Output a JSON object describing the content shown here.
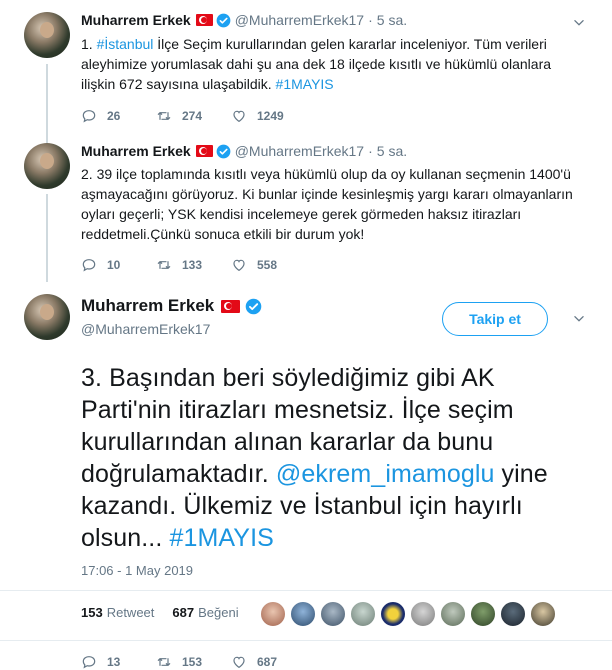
{
  "tweets": [
    {
      "name": "Muharrem Erkek",
      "handle": "@MuharremErkek17",
      "time": "5 sa.",
      "text_pre": "1. ",
      "text_link": "#İstanbul",
      "text_post": " İlçe Seçim kurullarından gelen kararlar inceleniyor. Tüm verileri aleyhimize yorumlasak dahi şu ana dek 18 ilçede kısıtlı ve hükümlü olanlara ilişkin 672 sayısına ulaşabildik. ",
      "text_tag": "#1MAYIS",
      "replies": "26",
      "retweets": "274",
      "likes": "1249"
    },
    {
      "name": "Muharrem Erkek",
      "handle": "@MuharremErkek17",
      "time": "5 sa.",
      "text": "2.  39 ilçe toplamında kısıtlı veya hükümlü olup da oy kullanan seçmenin 1400'ü aşmayacağını görüyoruz. Ki bunlar içinde kesinleşmiş yargı kararı olmayanların oyları geçerli; YSK kendisi incelemeye gerek görmeden haksız itirazları reddetmeli.Çünkü sonuca etkili bir durum yok!",
      "replies": "10",
      "retweets": "133",
      "likes": "558"
    }
  ],
  "main": {
    "name": "Muharrem Erkek",
    "handle": "@MuharremErkek17",
    "follow_label": "Takip et",
    "text_pre": "3. Başından beri söylediğimiz gibi AK Parti'nin itirazları mesnetsiz. İlçe seçim kurullarından alınan kararlar da bunu doğrulamaktadır. ",
    "mention": "@ekrem_imamoglu",
    "text_mid": " yine kazandı. Ülkemiz ve İstanbul için hayırlı olsun... ",
    "tag": "#1MAYIS",
    "timestamp": "17:06 - 1 May 2019",
    "retweet_count": "153",
    "retweet_label": "Retweet",
    "like_count": "687",
    "like_label": "Beğeni",
    "replies": "13",
    "retweets": "153",
    "likes": "687"
  },
  "colors": {
    "accent": "#1da1f2",
    "link": "#1b95e0",
    "muted": "#657786",
    "flag": "#e30a17"
  }
}
